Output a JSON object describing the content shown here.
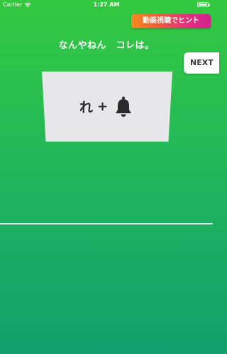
{
  "status_bar": {
    "carrier": "Carrier",
    "time": "1:27 AM"
  },
  "hint_button": {
    "label": "動画視聴でヒント"
  },
  "question": {
    "title": "なんやねん　コレは。"
  },
  "next_button": {
    "label": "NEXT"
  },
  "puzzle": {
    "character": "れ",
    "operator": "+",
    "image_icon": "bell-icon"
  },
  "colors": {
    "background_top": "#34c93f",
    "background_bottom": "#12a06e",
    "card": "#e7e7e9",
    "hint_gradient_start": "#f58a1f",
    "hint_gradient_end": "#d4228f"
  }
}
